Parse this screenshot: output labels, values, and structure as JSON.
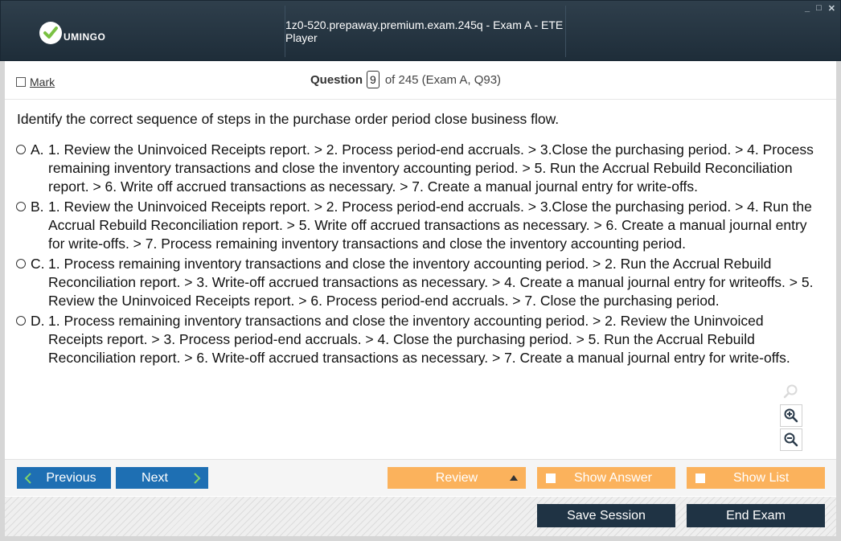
{
  "app": {
    "logo_text": "UMINGO",
    "window_title": "1z0-520.prepaway.premium.exam.245q - Exam A - ETE Player",
    "controls": {
      "minimize": "_",
      "maximize": "□",
      "close": "✕"
    }
  },
  "header": {
    "mark_label": "Mark",
    "question_label": "Question",
    "question_number": "9",
    "question_of": "of 245 (Exam A, Q93)"
  },
  "question": {
    "text": "Identify the correct sequence of steps in the purchase order period close business flow.",
    "options": [
      {
        "letter": "A.",
        "text": "1. Review the Uninvoiced Receipts report. > 2. Process period-end accruals. > 3.Close the purchasing period. > 4. Process remaining inventory transactions and close the inventory accounting period. > 5. Run the Accrual Rebuild Reconciliation report. > 6. Write off accrued transactions as necessary. > 7. Create a manual journal entry for write-offs."
      },
      {
        "letter": "B.",
        "text": "1. Review the Uninvoiced Receipts report. > 2. Process period-end accruals. > 3.Close the purchasing period. > 4. Run the Accrual Rebuild Reconciliation report. > 5. Write off accrued transactions as necessary. > 6. Create a manual journal entry for write-offs. > 7. Process remaining inventory transactions and close the inventory accounting period."
      },
      {
        "letter": "C.",
        "text": "1. Process remaining inventory transactions and close the inventory accounting period. > 2. Run the Accrual Rebuild Reconciliation report. > 3. Write-off accrued transactions as necessary. > 4. Create a manual journal entry for writeoffs. > 5. Review the Uninvoiced Receipts report. > 6. Process period-end accruals. > 7. Close the purchasing period."
      },
      {
        "letter": "D.",
        "text": "1. Process remaining inventory transactions and close the inventory accounting period. > 2. Review the Uninvoiced Receipts report. > 3. Process period-end accruals. > 4. Close the purchasing period. > 5. Run the Accrual Rebuild Reconciliation report. > 6. Write-off accrued transactions as necessary. > 7. Create a manual journal entry for write-offs."
      }
    ]
  },
  "nav": {
    "previous_label": "Previous",
    "next_label": "Next",
    "review_label": "Review",
    "show_answer_label": "Show Answer",
    "show_list_label": "Show List",
    "save_session_label": "Save Session",
    "end_exam_label": "End Exam"
  },
  "colors": {
    "titlebar": "#1e2d39",
    "nav_blue": "#1e6fb3",
    "orange": "#fbb25c",
    "dark_button": "#1f3344",
    "logo_green": "#7ac143"
  },
  "icons": {
    "logo": "check-icon",
    "zoom_search": "search-icon",
    "zoom_in": "zoom-in-icon",
    "zoom_out": "zoom-out-icon",
    "prev": "chevron-left-icon",
    "next": "chevron-right-icon",
    "review_toggle": "triangle-up-icon"
  }
}
